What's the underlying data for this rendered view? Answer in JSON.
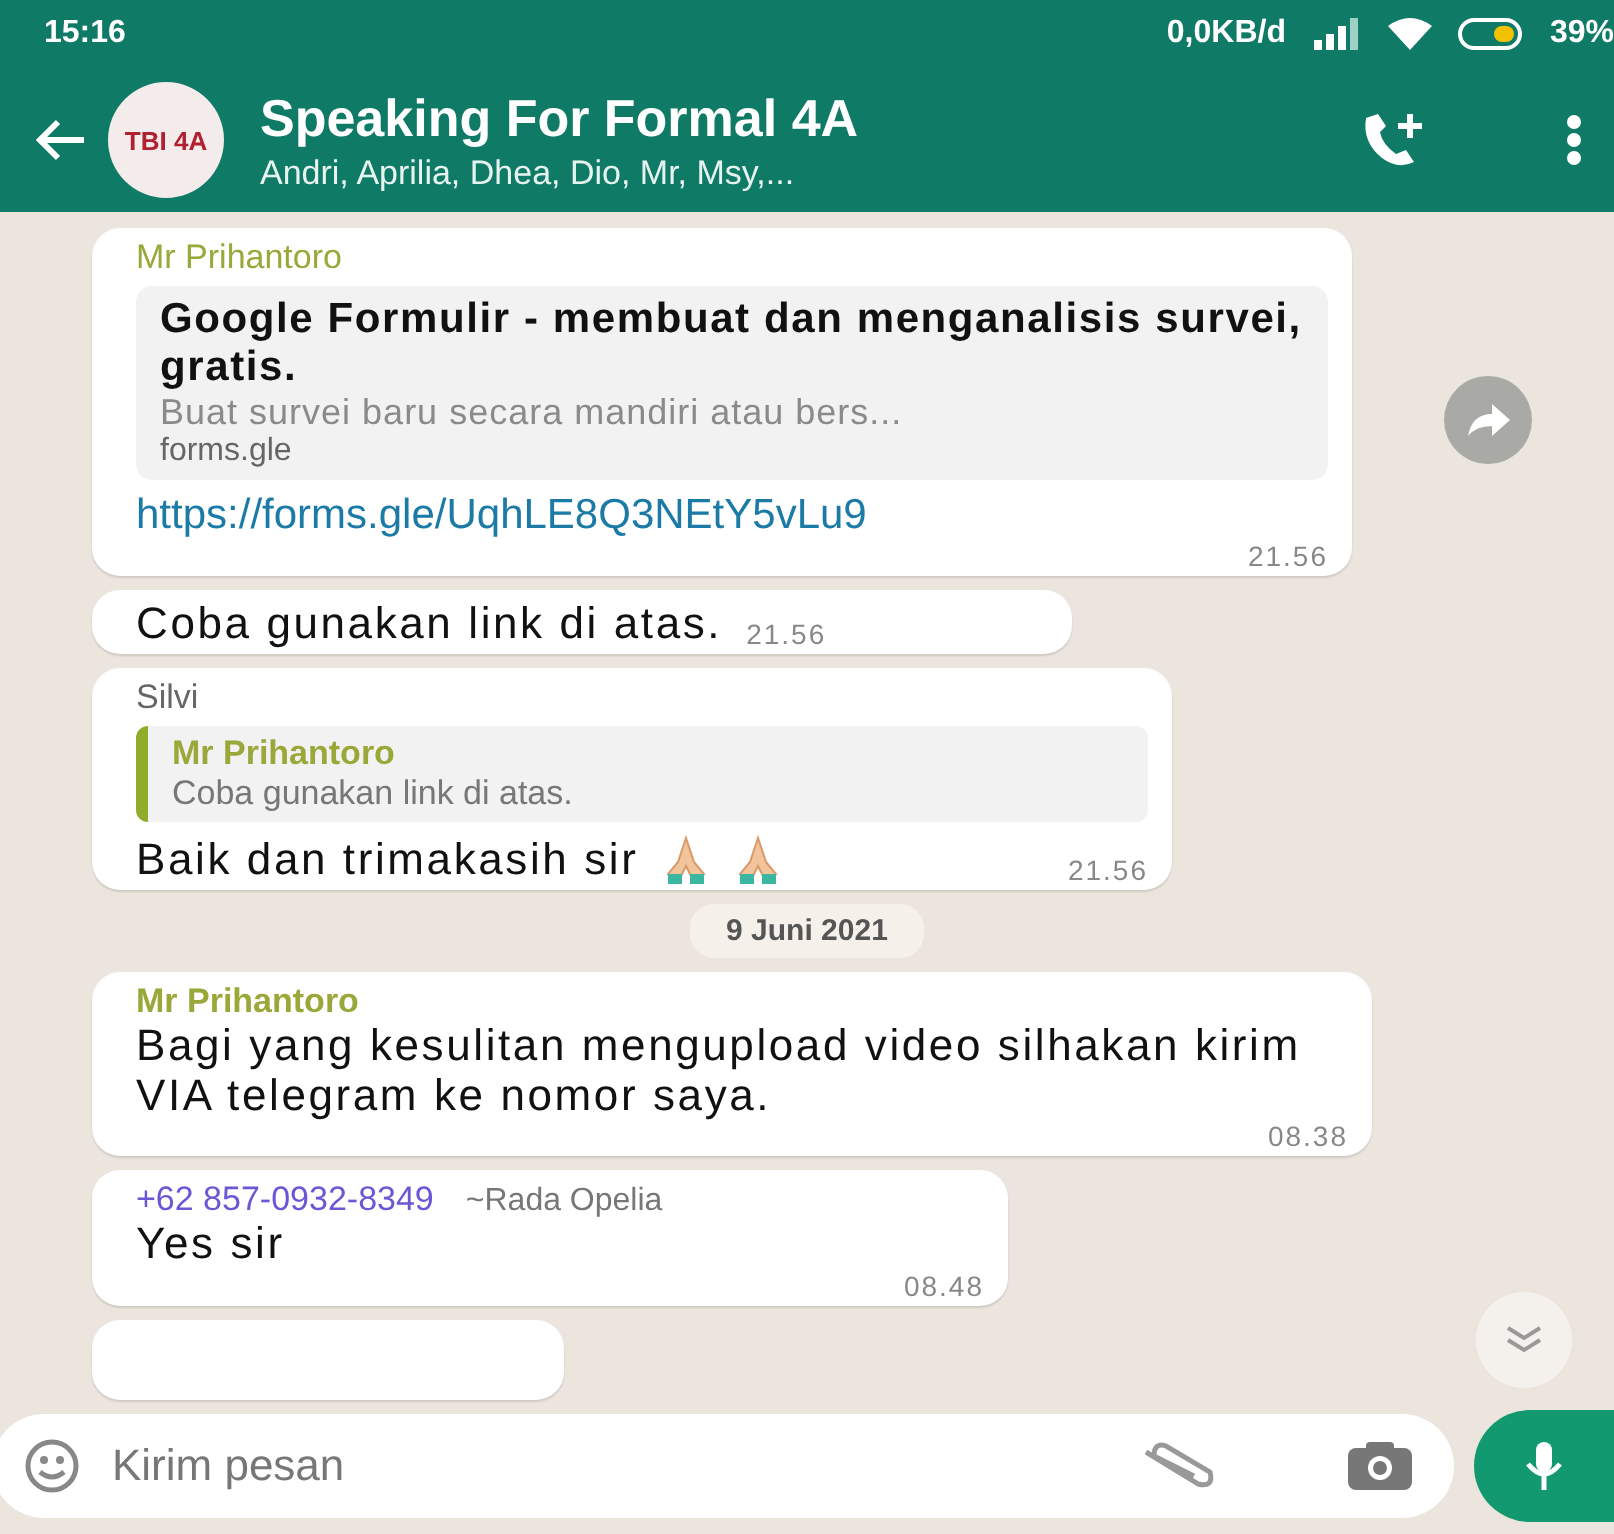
{
  "status_bar": {
    "time": "15:16",
    "data_rate": "0,0KB/d",
    "battery": "39%"
  },
  "header": {
    "title": "Speaking For Formal 4A",
    "subtitle": "Andri, Aprilia, Dhea, Dio, Mr, Msy,...",
    "avatar_text": "TBI 4A"
  },
  "messages": [
    {
      "kind": "link",
      "sender": "Mr Prihantoro",
      "preview_title": "Google Formulir - membuat dan menganalisis survei, gratis.",
      "preview_text": "Buat survei baru secara mandiri atau bers...",
      "preview_domain": "forms.gle",
      "link": "https://forms.gle/UqhLE8Q3NEtY5vLu9",
      "time": "21.56"
    },
    {
      "kind": "text",
      "text": "Coba gunakan link di atas.",
      "time": "21.56"
    },
    {
      "kind": "reply",
      "sender": "Silvi",
      "quote_sender": "Mr Prihantoro",
      "quote_text": "Coba gunakan link di atas.",
      "text": "Baik dan trimakasih sir",
      "time": "21.56"
    },
    {
      "kind": "date",
      "text": "9 Juni 2021"
    },
    {
      "kind": "text",
      "sender": "Mr Prihantoro",
      "text": "Bagi yang kesulitan mengupload video silhakan kirim VIA telegram ke nomor saya.",
      "time": "08.38"
    },
    {
      "kind": "text",
      "sender": "+62 857-0932-8349",
      "sender_alias": "~Rada Opelia",
      "text": "Yes sir",
      "time": "08.48"
    },
    {
      "kind": "partial"
    }
  ],
  "composer": {
    "placeholder": "Kirim pesan"
  }
}
